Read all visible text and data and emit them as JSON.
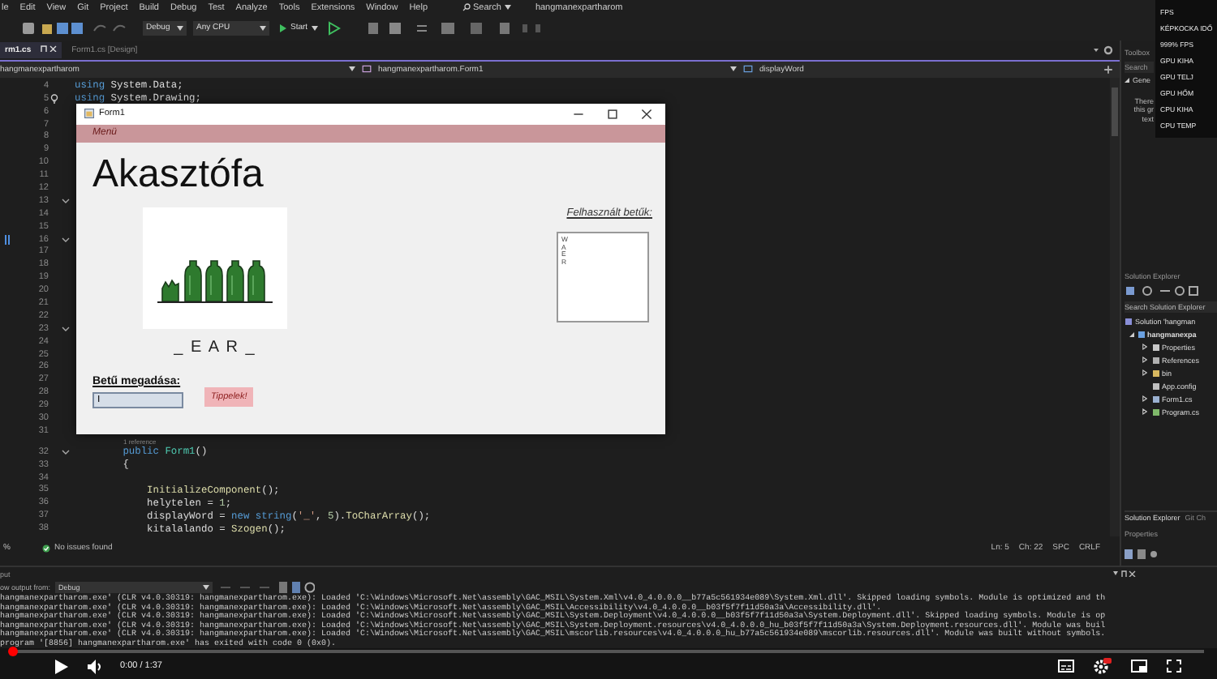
{
  "menu_bar": {
    "items": [
      "le",
      "Edit",
      "View",
      "Git",
      "Project",
      "Build",
      "Debug",
      "Test",
      "Analyze",
      "Tools",
      "Extensions",
      "Window",
      "Help"
    ],
    "search": "Search",
    "title": "hangmanexpartharom"
  },
  "toolbar": {
    "configuration": "Debug",
    "platform": "Any CPU",
    "start": "Start"
  },
  "doc_tabs": [
    {
      "label": "rm1.cs",
      "selected": true
    },
    {
      "label": "Form1.cs [Design]",
      "selected": false
    }
  ],
  "nav_bar": {
    "project": "hangmanexpartharom",
    "class": "hangmanexpartharom.Form1",
    "member": "displayWord"
  },
  "editor": {
    "lines": [
      {
        "num": "4",
        "fold": false,
        "segments": [
          {
            "kind": "keyword",
            "text": "using"
          },
          {
            "kind": "plain",
            "text": " System.Data;"
          }
        ]
      },
      {
        "num": "5",
        "fold": false,
        "lightbulb": true,
        "segments": [
          {
            "kind": "keyword",
            "text": "using"
          },
          {
            "kind": "plain",
            "text": " System.Drawing;"
          }
        ]
      },
      {
        "num": "6",
        "fold": false
      },
      {
        "num": "7",
        "fold": false
      },
      {
        "num": "8",
        "fold": false
      },
      {
        "num": "9",
        "fold": false
      },
      {
        "num": "10",
        "fold": false
      },
      {
        "num": "11",
        "fold": false
      },
      {
        "num": "12",
        "fold": false
      },
      {
        "num": "13",
        "fold": true
      },
      {
        "num": "14",
        "fold": false
      },
      {
        "num": "15",
        "fold": false
      },
      {
        "num": "16",
        "fold": true,
        "bookmark": true
      },
      {
        "num": "17",
        "fold": false
      },
      {
        "num": "18",
        "fold": false
      },
      {
        "num": "19",
        "fold": false
      },
      {
        "num": "20",
        "fold": false
      },
      {
        "num": "21",
        "fold": false
      },
      {
        "num": "22",
        "fold": false
      },
      {
        "num": "23",
        "fold": true
      },
      {
        "num": "24",
        "fold": false
      },
      {
        "num": "25",
        "fold": false
      },
      {
        "num": "26",
        "fold": false
      },
      {
        "num": "27",
        "fold": false
      },
      {
        "num": "28",
        "fold": false
      },
      {
        "num": "29",
        "fold": false
      },
      {
        "num": "30",
        "fold": false
      },
      {
        "num": "31",
        "fold": false
      },
      {
        "num": "32",
        "fold": true,
        "codelens": "1 reference",
        "segments": [
          {
            "kind": "keyword",
            "text": "        public"
          },
          {
            "kind": "type",
            "text": " Form1"
          },
          {
            "kind": "plain",
            "text": "()"
          }
        ]
      },
      {
        "num": "33",
        "fold": false,
        "segments": [
          {
            "kind": "plain",
            "text": "        {"
          }
        ]
      },
      {
        "num": "34",
        "fold": false
      },
      {
        "num": "35",
        "fold": false,
        "segments": [
          {
            "kind": "method",
            "text": "            InitializeComponent"
          },
          {
            "kind": "plain",
            "text": "();"
          }
        ]
      },
      {
        "num": "36",
        "fold": false,
        "segments": [
          {
            "kind": "plain",
            "text": "            helytelen = "
          },
          {
            "kind": "number",
            "text": "1"
          },
          {
            "kind": "plain",
            "text": ";"
          }
        ]
      },
      {
        "num": "37",
        "fold": false,
        "segments": [
          {
            "kind": "plain",
            "text": "            displayWord = "
          },
          {
            "kind": "keyword",
            "text": "new string"
          },
          {
            "kind": "plain",
            "text": "("
          },
          {
            "kind": "string",
            "text": "'_'"
          },
          {
            "kind": "plain",
            "text": ", "
          },
          {
            "kind": "number",
            "text": "5"
          },
          {
            "kind": "plain",
            "text": ")."
          },
          {
            "kind": "method",
            "text": "ToCharArray"
          },
          {
            "kind": "plain",
            "text": "();"
          }
        ]
      },
      {
        "num": "38",
        "fold": false,
        "segments": [
          {
            "kind": "plain",
            "text": "            kitalalando = "
          },
          {
            "kind": "method",
            "text": "Szogen"
          },
          {
            "kind": "plain",
            "text": "();"
          }
        ]
      }
    ],
    "status": {
      "zoom": "%",
      "issues": "No issues found",
      "line": "Ln: 5",
      "column": "Ch: 22",
      "spacing": "SPC",
      "line_ending": "CRLF"
    }
  },
  "form_window": {
    "title": "Form1",
    "menu": "Menü",
    "heading": "Akasztófa",
    "word": "_ E A R _",
    "used_letters_label": "Felhasznált betűk:",
    "used_letters": [
      "W",
      "A",
      "E",
      "R"
    ],
    "input_label": "Betű megadása:",
    "input_value": "I",
    "guess_button": "Tippelek!"
  },
  "perf_overlay": [
    "FPS",
    "KÉPKOCKA IDŐ",
    "999% FPS",
    "GPU KIHA",
    "GPU TELJ",
    "GPU HŐM",
    "CPU KIHA",
    "CPU TEMP"
  ],
  "toolbox": {
    "title": "Toolbox",
    "search": "Search",
    "group": "Gene",
    "message": [
      "There",
      "this gr",
      "text"
    ]
  },
  "solution_explorer": {
    "title": "Solution Explorer",
    "search_placeholder": "Search Solution Explorer",
    "tree": [
      {
        "label": "Solution 'hangman",
        "kind": "solution",
        "children": [
          {
            "label": "hangmanexpa",
            "kind": "project",
            "expanded": true,
            "children": [
              {
                "label": "Properties",
                "kind": "properties",
                "expanded": false
              },
              {
                "label": "References",
                "kind": "references",
                "expanded": false
              },
              {
                "label": "bin",
                "kind": "folder",
                "expanded": false
              },
              {
                "label": "App.config",
                "kind": "config"
              },
              {
                "label": "Form1.cs",
                "kind": "form",
                "expanded": false
              },
              {
                "label": "Program.cs",
                "kind": "csharp",
                "expanded": false
              }
            ]
          }
        ]
      }
    ],
    "tabs": [
      {
        "label": "Solution Explorer",
        "selected": true
      },
      {
        "label": "Git Ch",
        "selected": false
      }
    ]
  },
  "properties_panel": {
    "title": "Properties"
  },
  "output": {
    "title": "put",
    "source_label": "ow output from:",
    "source": "Debug",
    "lines": [
      "hangmanexpartharom.exe' (CLR v4.0.30319: hangmanexpartharom.exe): Loaded 'C:\\Windows\\Microsoft.Net\\assembly\\GAC_MSIL\\System.Xml\\v4.0_4.0.0.0__b77a5c561934e089\\System.Xml.dll'. Skipped loading symbols. Module is optimized and th",
      "hangmanexpartharom.exe' (CLR v4.0.30319: hangmanexpartharom.exe): Loaded 'C:\\Windows\\Microsoft.Net\\assembly\\GAC_MSIL\\Accessibility\\v4.0_4.0.0.0__b03f5f7f11d50a3a\\Accessibility.dll'.",
      "hangmanexpartharom.exe' (CLR v4.0.30319: hangmanexpartharom.exe): Loaded 'C:\\Windows\\Microsoft.Net\\assembly\\GAC_MSIL\\System.Deployment\\v4.0_4.0.0.0__b03f5f7f11d50a3a\\System.Deployment.dll'. Skipped loading symbols. Module is op",
      "hangmanexpartharom.exe' (CLR v4.0.30319: hangmanexpartharom.exe): Loaded 'C:\\Windows\\Microsoft.Net\\assembly\\GAC_MSIL\\System.Deployment.resources\\v4.0_4.0.0.0_hu_b03f5f7f11d50a3a\\System.Deployment.resources.dll'. Module was buil",
      "hangmanexpartharom.exe' (CLR v4.0.30319: hangmanexpartharom.exe): Loaded 'C:\\Windows\\Microsoft.Net\\assembly\\GAC_MSIL\\mscorlib.resources\\v4.0_4.0.0.0_hu_b77a5c561934e089\\mscorlib.resources.dll'. Module was built without symbols.",
      "program '[8856] hangmanexpartharom.exe' has exited with code 0 (0x0)."
    ]
  },
  "video_player": {
    "level": 0,
    "time": "0:00 / 1:37"
  }
}
